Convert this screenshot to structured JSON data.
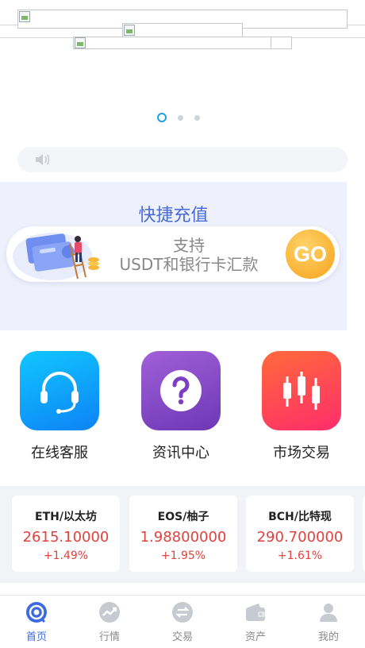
{
  "recharge": {
    "title": "快捷充值",
    "line1": "支持",
    "line2": "USDT和银行卡汇款",
    "go_label": "GO"
  },
  "features": [
    {
      "label": "在线客服",
      "icon": "headset-icon"
    },
    {
      "label": "资讯中心",
      "icon": "question-icon"
    },
    {
      "label": "市场交易",
      "icon": "candlestick-icon"
    }
  ],
  "market": [
    {
      "symbol": "ETH/以太坊",
      "price": "2615.10000",
      "change": "+1.49%"
    },
    {
      "symbol": "EOS/柚子",
      "price": "1.98800000",
      "change": "+1.95%"
    },
    {
      "symbol": "BCH/比特现",
      "price": "290.700000",
      "change": "+1.61%"
    }
  ],
  "nav": [
    {
      "label": "首页",
      "icon": "home-icon",
      "active": true
    },
    {
      "label": "行情",
      "icon": "trend-icon",
      "active": false
    },
    {
      "label": "交易",
      "icon": "exchange-icon",
      "active": false
    },
    {
      "label": "资产",
      "icon": "wallet-icon",
      "active": false
    },
    {
      "label": "我的",
      "icon": "user-icon",
      "active": false
    }
  ],
  "colors": {
    "accent": "#3d6ae0",
    "up": "#e2413c",
    "recharge_bg": "#eef0fb"
  }
}
